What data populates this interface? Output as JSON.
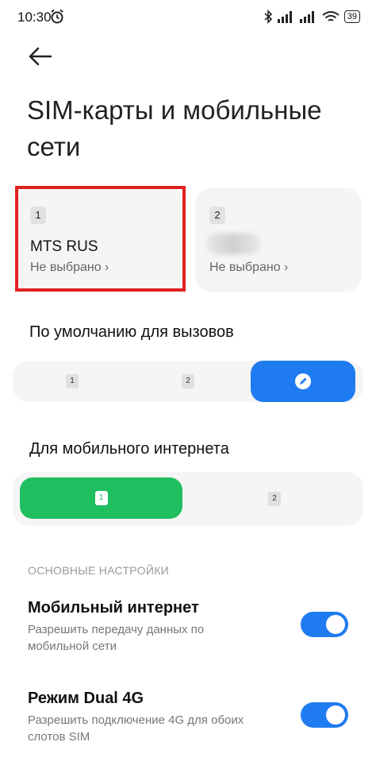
{
  "status_bar": {
    "time": "10:30",
    "battery": "39"
  },
  "page": {
    "title": "SIM-карты и мобильные сети"
  },
  "sim_cards": [
    {
      "number": "1",
      "name": "MTS RUS",
      "status": "Не выбрано ›"
    },
    {
      "number": "2",
      "name": "",
      "status": "Не выбрано ›"
    }
  ],
  "calls": {
    "heading": "По умолчанию для вызовов",
    "options": [
      {
        "label": "1"
      },
      {
        "label": "2"
      }
    ],
    "selected": "ask-icon"
  },
  "data": {
    "heading": "Для мобильного интернета",
    "options": [
      {
        "label": "1"
      },
      {
        "label": "2"
      }
    ],
    "selected": "1"
  },
  "basic": {
    "label": "ОСНОВНЫЕ НАСТРОЙКИ",
    "mobile_internet": {
      "title": "Мобильный интернет",
      "subtitle": "Разрешить передачу данных по мобильной сети",
      "enabled": true
    },
    "dual_4g": {
      "title": "Режим Dual 4G",
      "subtitle": "Разрешить подключение 4G для обоих слотов SIM",
      "enabled": true
    }
  },
  "colors": {
    "accent": "#1f7bf0",
    "data_selected": "#1fbf60",
    "highlight": "#e02020"
  }
}
